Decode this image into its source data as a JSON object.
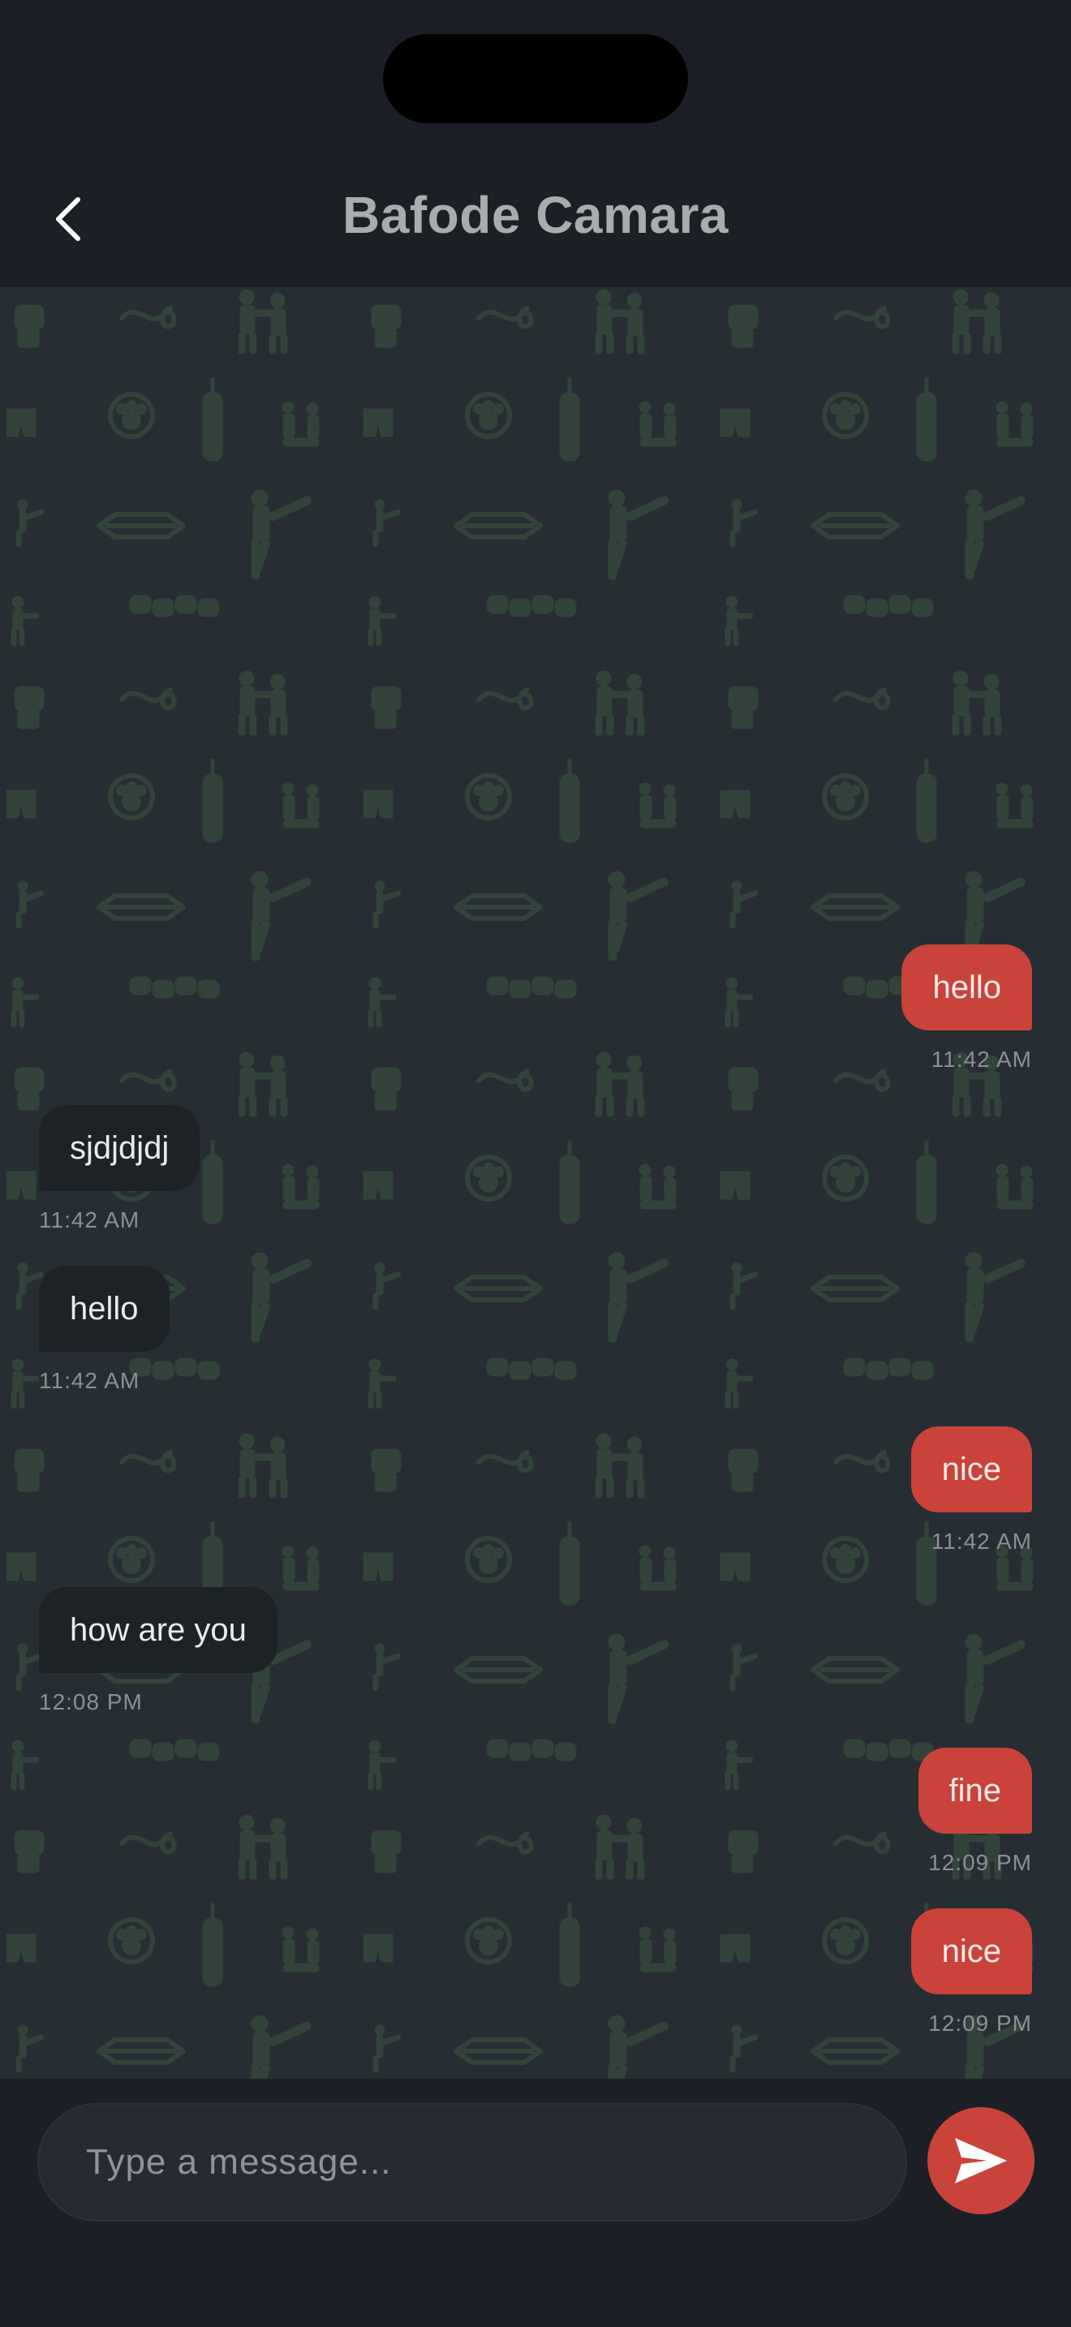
{
  "header": {
    "title": "Bafode Camara",
    "back_icon": "chevron-left-icon"
  },
  "background": {
    "pattern_icons": [
      "fist-icon",
      "wraps-icon",
      "fighters-icon",
      "paw-icon",
      "punching-bag-icon",
      "shorts-icon",
      "ring-icon",
      "kick-icon",
      "gloves-icon"
    ],
    "pattern_color": "#34473c",
    "base_color": "#262d33"
  },
  "messages": [
    {
      "direction": "out",
      "text": "hello",
      "time": "11:42 AM"
    },
    {
      "direction": "in",
      "text": "sjdjdjdj",
      "time": "11:42 AM"
    },
    {
      "direction": "in",
      "text": "hello",
      "time": "11:42 AM"
    },
    {
      "direction": "out",
      "text": "nice",
      "time": "11:42 AM"
    },
    {
      "direction": "in",
      "text": "how are you",
      "time": "12:08 PM"
    },
    {
      "direction": "out",
      "text": "fine",
      "time": "12:09 PM"
    },
    {
      "direction": "out",
      "text": "nice",
      "time": "12:09 PM"
    }
  ],
  "composer": {
    "placeholder": "Type a message...",
    "value": "",
    "send_icon": "send-icon"
  },
  "colors": {
    "accent": "#c9433a",
    "incoming_bubble": "#1d2227",
    "header_bg": "#1c2026"
  }
}
